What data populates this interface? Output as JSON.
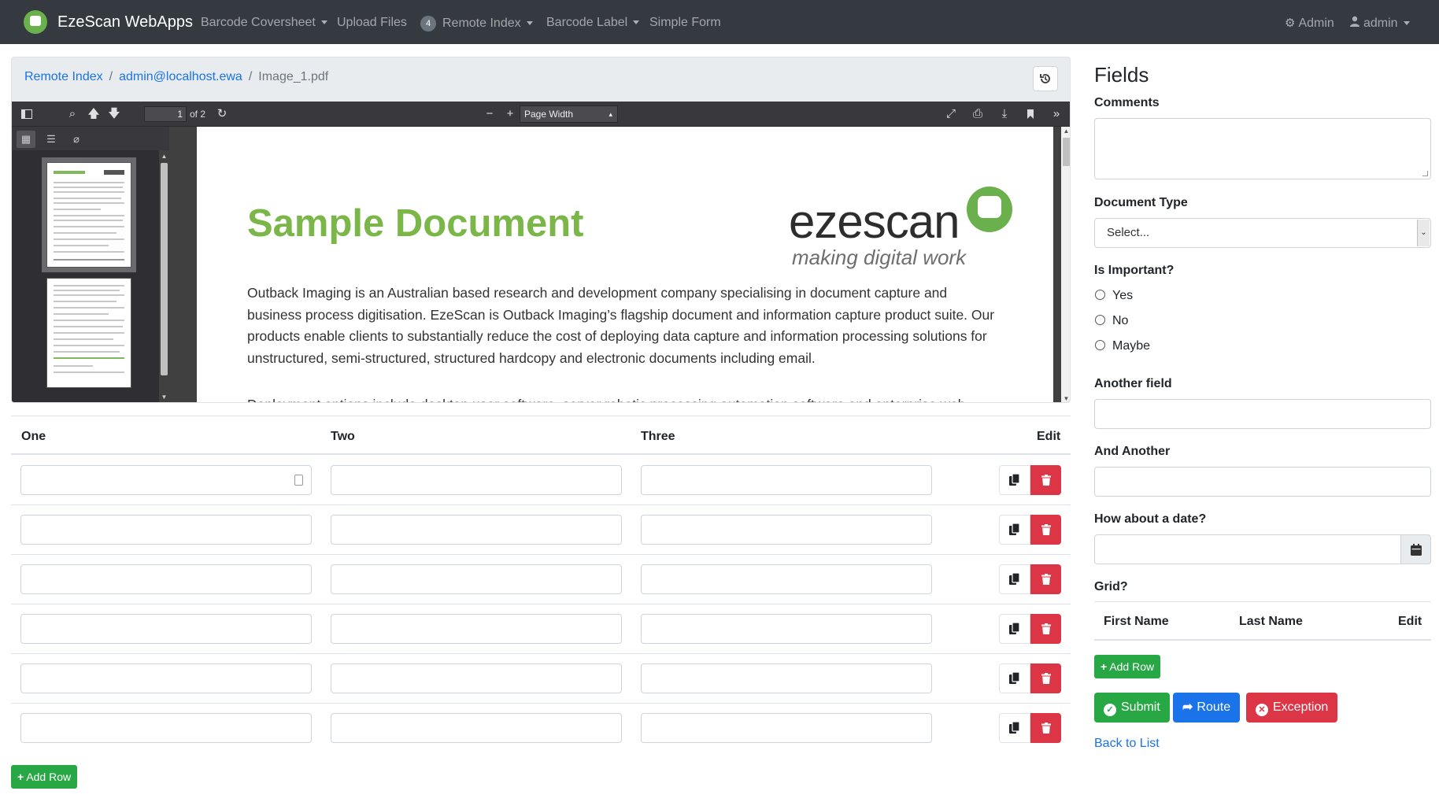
{
  "navbar": {
    "brand": "EzeScan WebApps",
    "items": [
      {
        "label": "Barcode Coversheet",
        "dropdown": true
      },
      {
        "label": "Upload Files",
        "dropdown": false
      },
      {
        "label": "Remote Index",
        "dropdown": true,
        "badge": "4"
      },
      {
        "label": "Barcode Label",
        "dropdown": true
      },
      {
        "label": "Simple Form",
        "dropdown": false
      }
    ],
    "admin_menu": "Admin",
    "user_menu": "admin"
  },
  "breadcrumb": {
    "items": [
      "Remote Index",
      "admin@localhost.ewa"
    ],
    "active": "Image_1.pdf"
  },
  "pdf_viewer": {
    "page_number": "1",
    "page_count_text": "of 2",
    "zoom": "Page Width",
    "document": {
      "title": "Sample Document",
      "logo_word": "ezescan",
      "logo_tagline": "making digital work",
      "paragraph1": "Outback Imaging is an Australian based research and development company specialising in document capture and business process digitisation. EzeScan is Outback Imaging’s flagship document and information capture product suite. Our products enable clients to substantially reduce the cost of deploying data capture and information processing solutions for unstructured, semi-structured, structured hardcopy and electronic documents including email.",
      "paragraph2": "Deployment options include desktop user software, server robotic processing automation software and enterprise web"
    }
  },
  "table": {
    "columns": [
      "One",
      "Two",
      "Three",
      "Edit"
    ],
    "row_count": 6,
    "add_row_label": "Add Row"
  },
  "form": {
    "title": "Fields",
    "comments_label": "Comments",
    "document_type_label": "Document Type",
    "document_type_value": "Select...",
    "important_label": "Is Important?",
    "important_options": [
      "Yes",
      "No",
      "Maybe"
    ],
    "another_field_label": "Another field",
    "and_another_label": "And Another",
    "date_label": "How about a date?",
    "grid_label": "Grid?",
    "grid_columns": [
      "First Name",
      "Last Name",
      "Edit"
    ],
    "add_row_label": "Add Row",
    "submit_label": "Submit",
    "route_label": "Route",
    "exception_label": "Exception",
    "back_label": "Back to List"
  },
  "colors": {
    "navbar": "#343a40",
    "brand_green": "#7ab648",
    "success": "#28a745",
    "primary": "#1a73e8",
    "danger": "#dc3545"
  }
}
